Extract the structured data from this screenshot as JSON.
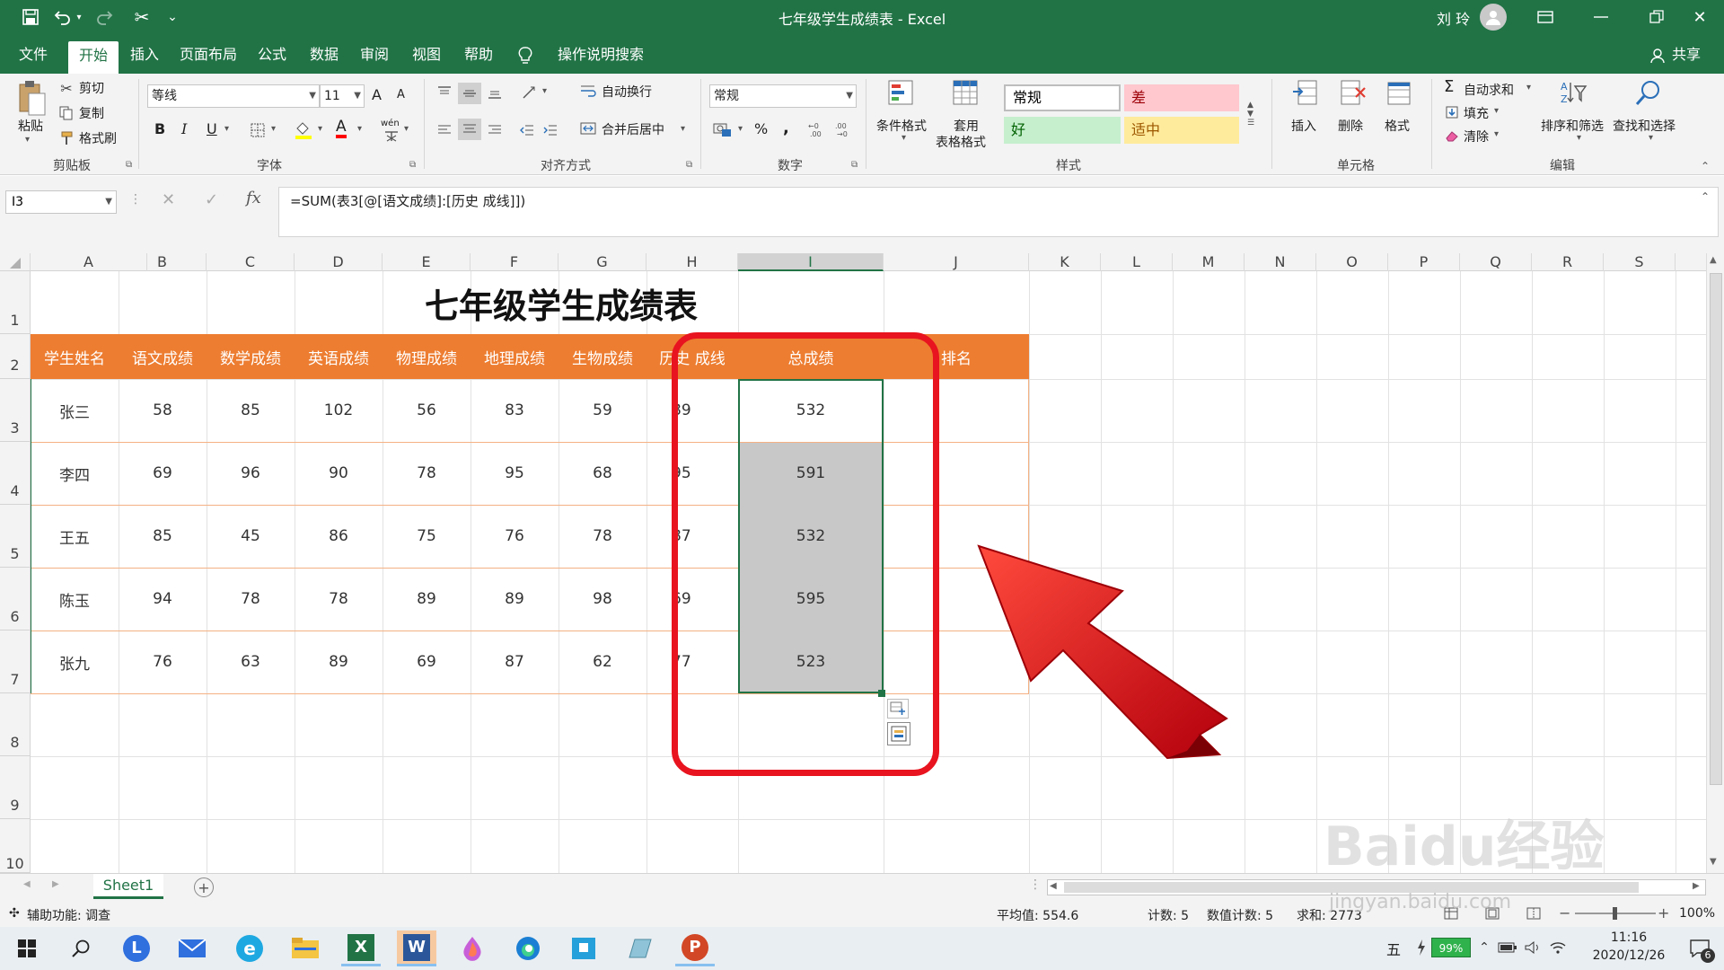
{
  "window": {
    "title": "七年级学生成绩表 - Excel",
    "user": "刘 玲",
    "qat_more": "⌄"
  },
  "tabs": [
    {
      "label": "文件"
    },
    {
      "label": "开始"
    },
    {
      "label": "插入"
    },
    {
      "label": "页面布局"
    },
    {
      "label": "公式"
    },
    {
      "label": "数据"
    },
    {
      "label": "审阅"
    },
    {
      "label": "视图"
    },
    {
      "label": "帮助"
    },
    {
      "label": "操作说明搜索"
    }
  ],
  "share": "共享",
  "ribbon": {
    "clipboard": {
      "paste": "粘贴",
      "cut": "剪切",
      "copy": "复制",
      "format_painter": "格式刷",
      "label": "剪贴板"
    },
    "font": {
      "name": "等线",
      "size": "11",
      "bold": "B",
      "italic": "I",
      "underline": "U",
      "grow": "A",
      "shrink": "A",
      "font_color": "A",
      "wen": "wén",
      "label": "字体"
    },
    "alignment": {
      "wrap": "自动换行",
      "merge": "合并后居中",
      "label": "对齐方式"
    },
    "number": {
      "format": "常规",
      "percent": "%",
      "comma": ",",
      "label": "数字"
    },
    "styles": {
      "conditional": "条件格式",
      "table_line1": "套用",
      "table_line2": "表格格式",
      "normal": "常规",
      "bad": "差",
      "good": "好",
      "neutral": "适中",
      "label": "样式"
    },
    "cells": {
      "insert": "插入",
      "delete": "删除",
      "format": "格式",
      "label": "单元格"
    },
    "editing": {
      "autosum": "自动求和",
      "fill": "填充",
      "clear": "清除",
      "sort": "排序和筛选",
      "find": "查找和选择",
      "label": "编辑"
    }
  },
  "formula_bar": {
    "name_box": "I3",
    "formula": "=SUM(表3[@[语文成绩]:[历史 成线]])",
    "fx": "fx"
  },
  "columns": [
    "A",
    "B",
    "C",
    "D",
    "E",
    "F",
    "G",
    "H",
    "I",
    "J",
    "K",
    "L",
    "M",
    "N",
    "O",
    "P",
    "Q",
    "R",
    "S"
  ],
  "rows": [
    "1",
    "2",
    "3",
    "4",
    "5",
    "6",
    "7",
    "8",
    "9",
    "10"
  ],
  "sheet": {
    "title": "七年级学生成绩表",
    "headers": [
      "学生姓名",
      "语文成绩",
      "数学成绩",
      "英语成绩",
      "物理成绩",
      "地理成绩",
      "生物成绩",
      "历史 成线",
      "总成绩",
      "排名"
    ],
    "data": [
      [
        "张三",
        "58",
        "85",
        "102",
        "56",
        "83",
        "59",
        "89",
        "532",
        ""
      ],
      [
        "李四",
        "69",
        "96",
        "90",
        "78",
        "95",
        "68",
        "95",
        "591",
        ""
      ],
      [
        "王五",
        "85",
        "45",
        "86",
        "75",
        "76",
        "78",
        "87",
        "532",
        ""
      ],
      [
        "陈玉",
        "94",
        "78",
        "78",
        "89",
        "89",
        "98",
        "69",
        "595",
        ""
      ],
      [
        "张九",
        "76",
        "63",
        "89",
        "69",
        "87",
        "62",
        "77",
        "523",
        ""
      ]
    ]
  },
  "sheet_tabs": [
    {
      "label": "Sheet1"
    }
  ],
  "status": {
    "accessibility": "辅助功能: 调查",
    "average": "平均值: 554.6",
    "count": "计数: 5",
    "numeric_count": "数值计数: 5",
    "sum": "求和: 2773",
    "zoom": "100%"
  },
  "taskbar": {
    "ime": "五",
    "battery": "99%",
    "time": "11:16",
    "date": "2020/12/26",
    "notifications": "6"
  },
  "watermark": "Baidu经验",
  "watermark_url": "jingyan.baidu.com",
  "colors": {
    "excel_green": "#217346",
    "header_orange": "#ed7d31",
    "red_highlight": "#e8141f",
    "gray_fill": "#c8c8c8"
  }
}
